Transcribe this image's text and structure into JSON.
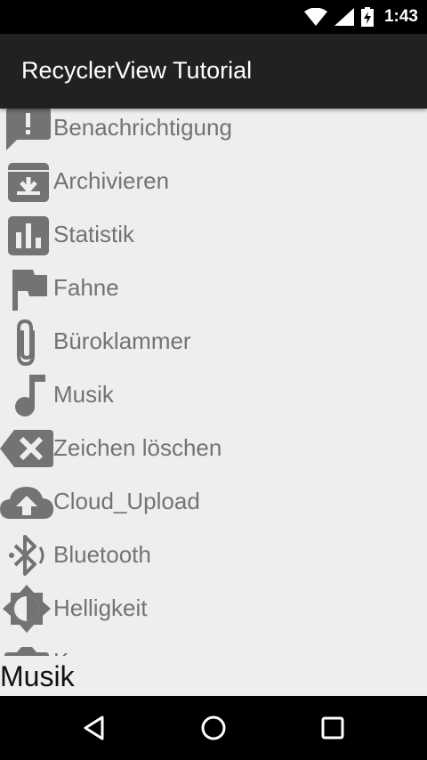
{
  "status_bar": {
    "time": "1:43"
  },
  "app_bar": {
    "title": "RecyclerView Tutorial"
  },
  "list": {
    "items": [
      {
        "icon": "feedback-icon",
        "label": "Benachrichtigung"
      },
      {
        "icon": "archive-icon",
        "label": "Archivieren"
      },
      {
        "icon": "chart-icon",
        "label": "Statistik"
      },
      {
        "icon": "flag-icon",
        "label": "Fahne"
      },
      {
        "icon": "paperclip-icon",
        "label": "Büroklammer"
      },
      {
        "icon": "music-note-icon",
        "label": "Musik"
      },
      {
        "icon": "backspace-icon",
        "label": "Zeichen löschen"
      },
      {
        "icon": "cloud-upload-icon",
        "label": "Cloud_Upload"
      },
      {
        "icon": "bluetooth-icon",
        "label": "Bluetooth"
      },
      {
        "icon": "brightness-icon",
        "label": "Helligkeit"
      },
      {
        "icon": "camera-icon",
        "label": "K"
      }
    ]
  },
  "selection": {
    "text": "Musik"
  },
  "colors": {
    "icon_gray": "#737373",
    "background": "#eeeeee",
    "app_bar": "#212121"
  }
}
